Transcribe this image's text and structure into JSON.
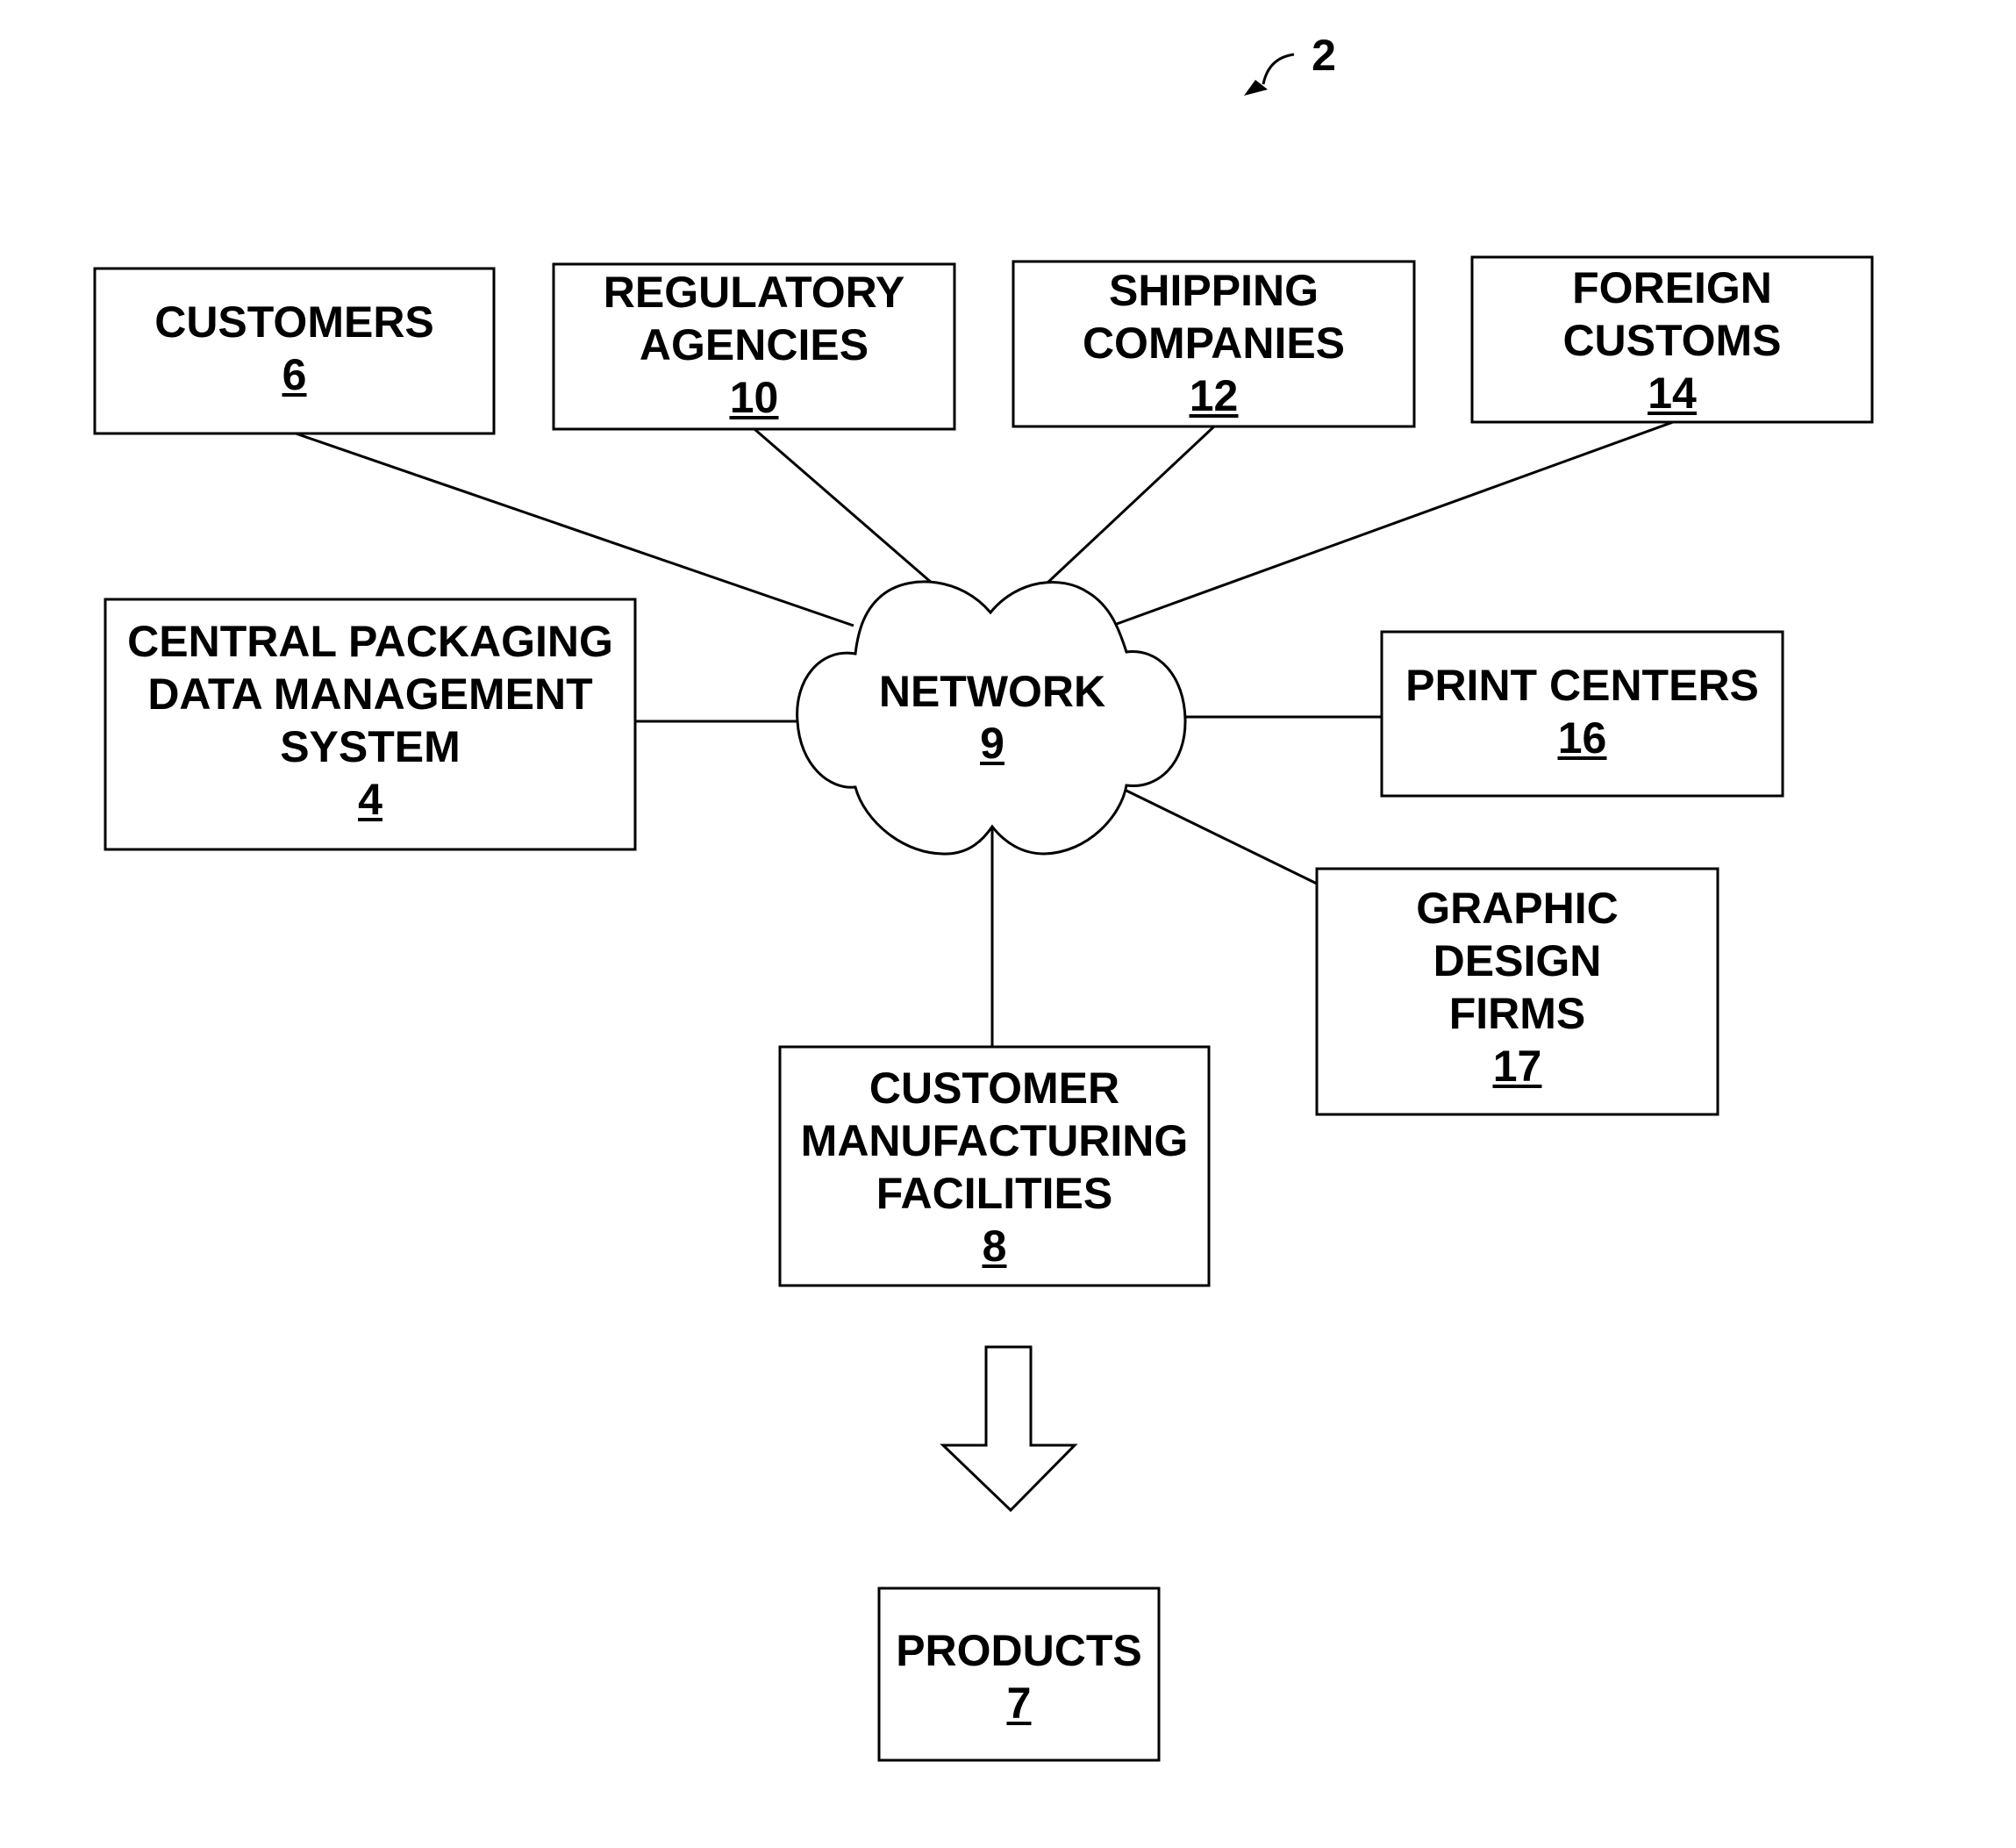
{
  "figure": {
    "reference_numeral": "2",
    "network": {
      "lines": [
        "NETWORK"
      ],
      "ref": "9"
    },
    "nodes": {
      "customers": {
        "lines": [
          "CUSTOMERS"
        ],
        "ref": "6"
      },
      "regulatory_agencies": {
        "lines": [
          "REGULATORY",
          "AGENCIES"
        ],
        "ref": "10"
      },
      "shipping_companies": {
        "lines": [
          "SHIPPING",
          "COMPANIES"
        ],
        "ref": "12"
      },
      "foreign_customs": {
        "lines": [
          "FOREIGN",
          "CUSTOMS"
        ],
        "ref": "14"
      },
      "central_packaging": {
        "lines": [
          "CENTRAL PACKAGING",
          "DATA MANAGEMENT",
          "SYSTEM"
        ],
        "ref": "4"
      },
      "print_centers": {
        "lines": [
          "PRINT CENTERS"
        ],
        "ref": "16"
      },
      "graphic_design_firms": {
        "lines": [
          "GRAPHIC",
          "DESIGN",
          "FIRMS"
        ],
        "ref": "17"
      },
      "customer_manufacturing": {
        "lines": [
          "CUSTOMER",
          "MANUFACTURING",
          "FACILITIES"
        ],
        "ref": "8"
      },
      "products": {
        "lines": [
          "PRODUCTS"
        ],
        "ref": "7"
      }
    },
    "connections": [
      [
        "customers",
        "network"
      ],
      [
        "regulatory_agencies",
        "network"
      ],
      [
        "shipping_companies",
        "network"
      ],
      [
        "foreign_customs",
        "network"
      ],
      [
        "central_packaging",
        "network"
      ],
      [
        "print_centers",
        "network"
      ],
      [
        "graphic_design_firms",
        "network"
      ],
      [
        "customer_manufacturing",
        "network"
      ]
    ],
    "flow": {
      "from": "customer_manufacturing",
      "to": "products"
    }
  }
}
